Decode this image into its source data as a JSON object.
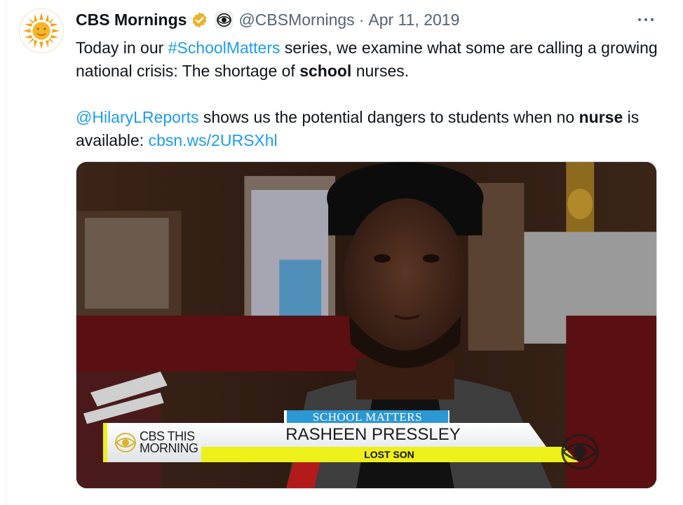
{
  "tweet": {
    "display_name": "CBS Mornings",
    "handle": "@CBSMornings",
    "separator": "·",
    "date": "Apr 11, 2019",
    "more_icon": "more-horizontal-icon",
    "verified_icon": "verified-gold-badge-icon",
    "affiliate_icon": "cbs-eye-affiliate-icon",
    "avatar_icon": "cbs-sun-logo-icon",
    "body": {
      "p1_a": "Today in our ",
      "p1_hashtag": "#SchoolMatters",
      "p1_b": " series, we examine what some are calling a growing national crisis: The shortage of ",
      "p1_bold": "school",
      "p1_c": " nurses.",
      "p2_mention": "@HilaryLReports",
      "p2_a": " shows us the potential dangers to students when no ",
      "p2_bold": "nurse",
      "p2_b": " is available: ",
      "p2_link": "cbsn.ws/2URSXhl"
    }
  },
  "media": {
    "banner_tag": "SCHOOL MATTERS",
    "banner_name": "RASHEEN PRESSLEY",
    "banner_sub": "LOST SON",
    "logo_text": "CBS THIS MORNING"
  },
  "colors": {
    "link": "#1d9bf0",
    "secondary_text": "#536471",
    "verified_gold": "#e8b32e",
    "banner_blue": "#2c98d3",
    "banner_yellow": "#eef01a"
  }
}
